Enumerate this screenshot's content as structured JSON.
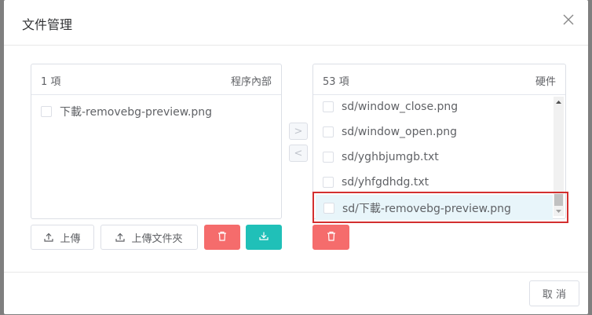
{
  "dialog": {
    "title": "文件管理"
  },
  "left_panel": {
    "count": "1 項",
    "title": "程序內部",
    "items": [
      {
        "label": "下載-removebg-preview.png"
      }
    ]
  },
  "right_panel": {
    "count": "53 項",
    "title": "硬件",
    "items": [
      {
        "label": "sd/window_close.png"
      },
      {
        "label": "sd/window_open.png"
      },
      {
        "label": "sd/yghbjumgb.txt"
      },
      {
        "label": "sd/yhfgdhdg.txt"
      },
      {
        "label": "sd/下載-removebg-preview.png"
      }
    ]
  },
  "transfer": {
    "right_label": ">",
    "left_label": "<"
  },
  "buttons": {
    "upload": "上傳",
    "upload_folder": "上傳文件夾",
    "cancel": "取 消"
  },
  "colors": {
    "danger": "#f56c6c",
    "teal": "#20c0b8",
    "highlight_border": "#d32f2f"
  },
  "icons": [
    "close-icon",
    "upload-icon",
    "trash-icon",
    "download-icon",
    "scroll-up-icon",
    "scroll-down-icon"
  ]
}
